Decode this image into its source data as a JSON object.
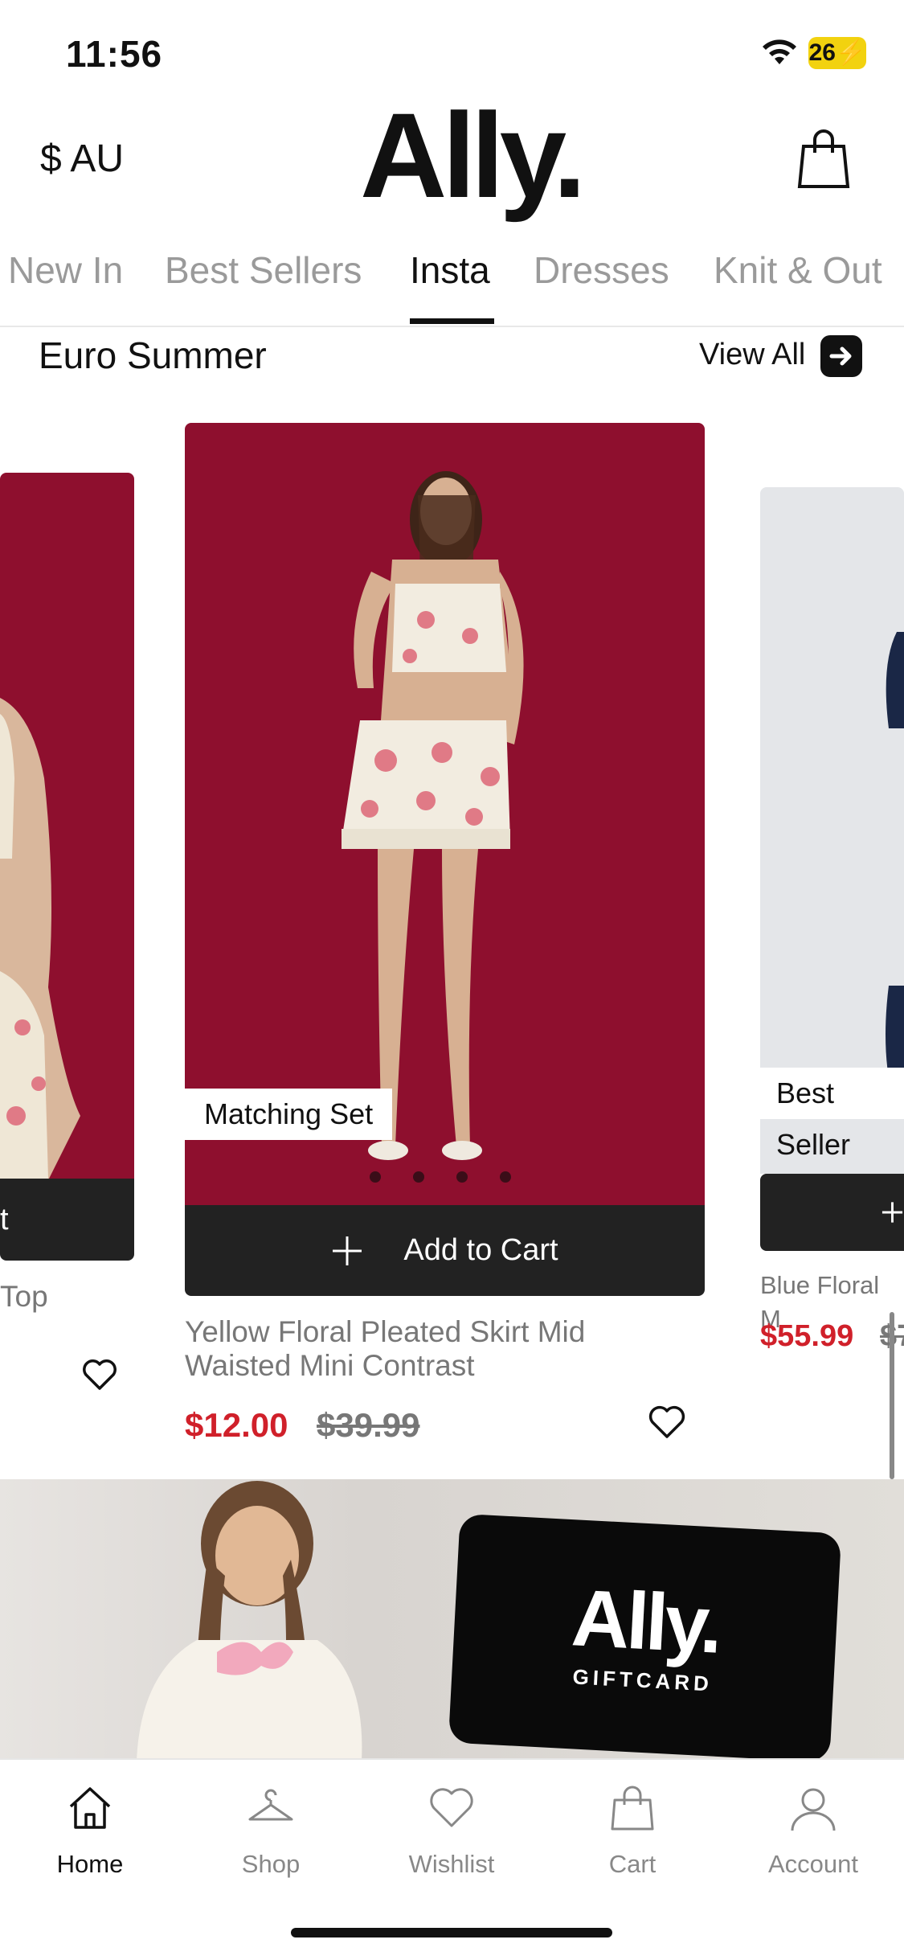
{
  "status_bar": {
    "time": "11:56",
    "battery": "26"
  },
  "header": {
    "currency": "$ AU",
    "logo": "Ally."
  },
  "category_tabs": [
    {
      "label": "New In",
      "active": false
    },
    {
      "label": "Best Sellers",
      "active": false
    },
    {
      "label": "Insta",
      "active": true
    },
    {
      "label": "Dresses",
      "active": false
    },
    {
      "label": "Knit & Out",
      "active": false
    }
  ],
  "section": {
    "title": "Euro Summer",
    "view_all": "View All"
  },
  "products": {
    "left": {
      "cart_label": "t",
      "name": "Top"
    },
    "center": {
      "badge": "Matching Set",
      "cart_label": "Add to Cart",
      "name": "Yellow Floral Pleated Skirt Mid Waisted Mini Contrast",
      "sale_price": "$12.00",
      "original_price": "$39.99"
    },
    "right": {
      "badge": "Best Seller",
      "name": "Blue Floral M",
      "sale_price": "$55.99",
      "original_price": "$7"
    }
  },
  "banner": {
    "card_logo": "Ally.",
    "card_sub": "GIFTCARD"
  },
  "tab_bar": [
    {
      "label": "Home",
      "icon": "home-icon",
      "active": true
    },
    {
      "label": "Shop",
      "icon": "hanger-icon",
      "active": false
    },
    {
      "label": "Wishlist",
      "icon": "heart-icon",
      "active": false
    },
    {
      "label": "Cart",
      "icon": "bag-icon",
      "active": false
    },
    {
      "label": "Account",
      "icon": "account-icon",
      "active": false
    }
  ],
  "colors": {
    "brand_red": "#8e0f2e",
    "sale_red": "#d0202a",
    "dark": "#222222"
  }
}
